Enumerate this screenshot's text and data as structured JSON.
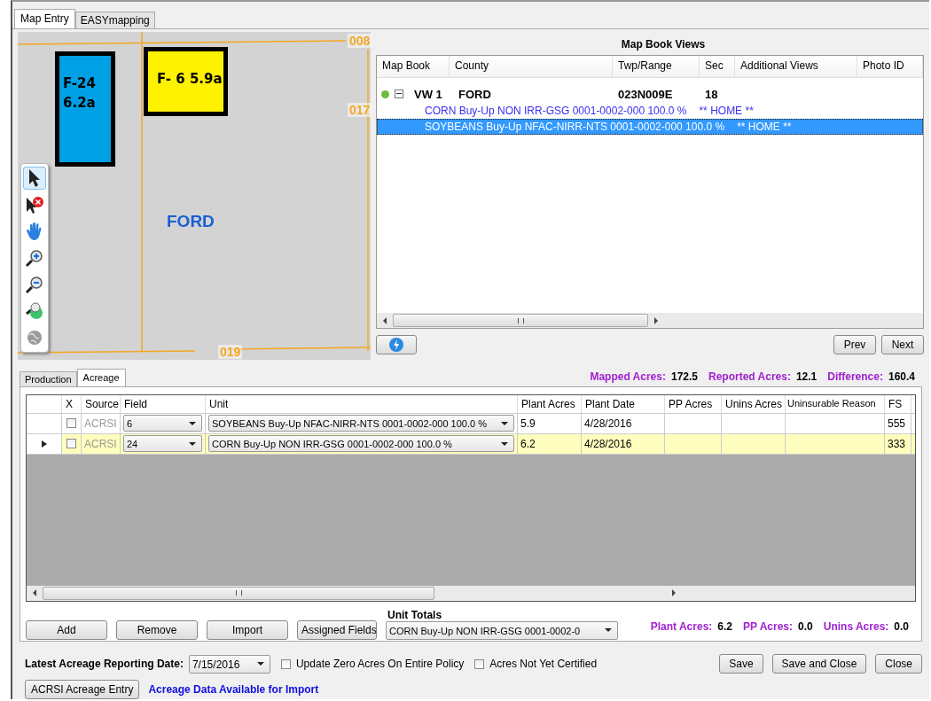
{
  "tabs": [
    {
      "label": "Map Entry",
      "selected": true
    },
    {
      "label": "EASYmapping",
      "selected": false
    }
  ],
  "map": {
    "road_labels": [
      "008",
      "017",
      "019"
    ],
    "fields": [
      {
        "lines": [
          "F-24",
          "6.2a"
        ],
        "color": "#00a0e4"
      },
      {
        "lines": [
          "F- 6 5.9a"
        ],
        "color": "#fff200"
      }
    ],
    "county": "FORD",
    "tools": [
      {
        "kind": "pointer",
        "selected": true
      },
      {
        "kind": "clear",
        "selected": false
      },
      {
        "kind": "pan",
        "selected": false
      },
      {
        "kind": "zoom-in",
        "selected": false
      },
      {
        "kind": "zoom-out",
        "selected": false
      },
      {
        "kind": "zoom-full",
        "selected": false
      },
      {
        "kind": "globe",
        "selected": false
      }
    ]
  },
  "map_book_views": {
    "title": "Map Book Views",
    "columns": [
      "Map Book",
      "County",
      "Twp/Range",
      "Sec",
      "Additional Views",
      "Photo ID"
    ],
    "groups": [
      {
        "expanded": true,
        "map_book": "VW 1",
        "county": "FORD",
        "twp_range": "023N009E",
        "sec": "18",
        "children": [
          {
            "text": "CORN  Buy-Up  NON IRR-GSG  0001-0002-000  100.0 %",
            "views": "** HOME **",
            "selected": false
          },
          {
            "text": "SOYBEANS  Buy-Up  NFAC-NIRR-NTS  0001-0002-000  100.0 %",
            "views": "** HOME **",
            "selected": true
          }
        ]
      }
    ],
    "buttons": [
      "Prev",
      "Next"
    ]
  },
  "bottom_tabs": [
    {
      "label": "Production",
      "selected": false
    },
    {
      "label": "Acreage",
      "selected": true
    }
  ],
  "summary": [
    {
      "label": "Mapped Acres:",
      "value": "172.5"
    },
    {
      "label": "Reported Acres:",
      "value": "12.1"
    },
    {
      "label": "Difference:",
      "value": "160.4"
    }
  ],
  "grid": {
    "columns": [
      "X",
      "Source",
      "Field",
      "Unit",
      "Plant Acres",
      "Plant Date",
      "PP Acres",
      "Unins Acres",
      "Uninsurable Reason",
      "FS"
    ],
    "rows": [
      {
        "selected": false,
        "checked": false,
        "source": "ACRSI",
        "field": "6",
        "unit": "SOYBEANS Buy-Up NFAC-NIRR-NTS 0001-0002-000 100.0 %",
        "plant_acres": "5.9",
        "plant_date": "4/28/2016",
        "fsn": "555"
      },
      {
        "selected": true,
        "checked": false,
        "source": "ACRSI",
        "field": "24",
        "unit": "CORN Buy-Up NON IRR-GSG 0001-0002-000 100.0 %",
        "plant_acres": "6.2",
        "plant_date": "4/28/2016",
        "fsn": "333"
      }
    ]
  },
  "actions": [
    "Add",
    "Remove",
    "Import",
    "Assigned Fields"
  ],
  "unit_totals": {
    "label": "Unit Totals",
    "value": "CORN Buy-Up NON IRR-GSG 0001-0002-0"
  },
  "totals": [
    {
      "label": "Plant Acres:",
      "value": "6.2"
    },
    {
      "label": "PP Acres:",
      "value": "0.0"
    },
    {
      "label": "Unins Acres:",
      "value": "0.0"
    }
  ],
  "footer": {
    "date_label": "Latest Acreage Reporting Date:",
    "date": "7/15/2016",
    "checkboxes": [
      {
        "label": "Update Zero Acres On Entire Policy",
        "checked": false
      },
      {
        "label": "Acres Not Yet Certified",
        "checked": false
      }
    ],
    "buttons": [
      "Save",
      "Save and Close",
      "Close"
    ],
    "acrsi_button": "ACRSI Acreage Entry",
    "import_note": "Acreage Data Available for Import"
  }
}
